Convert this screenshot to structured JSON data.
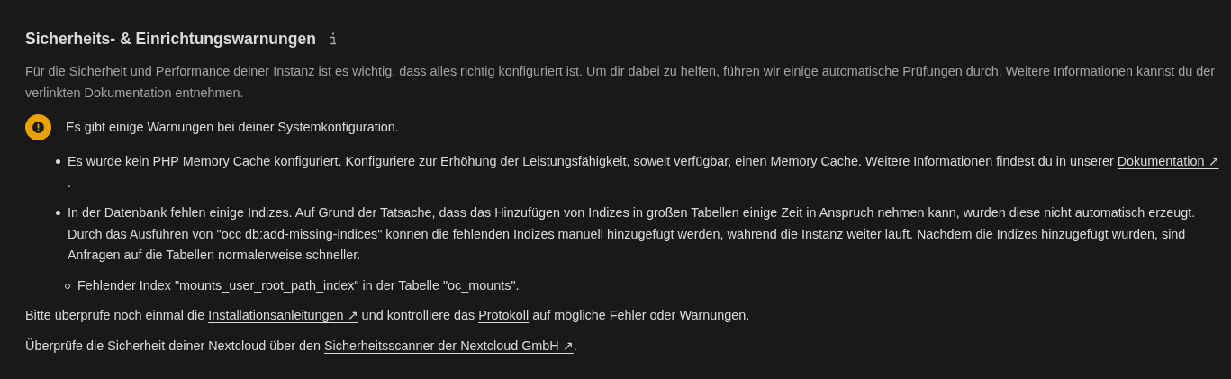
{
  "section": {
    "title": "Sicherheits- & Einrichtungswarnungen",
    "description": "Für die Sicherheit und Performance deiner Instanz ist es wichtig, dass alles richtig konfiguriert ist. Um dir dabei zu helfen, führen wir einige automatische Prüfungen durch. Weitere Informationen kannst du der verlinkten Dokumentation entnehmen.",
    "status": {
      "kind": "warning",
      "text": "Es gibt einige Warnungen bei deiner Systemkonfiguration."
    },
    "issues": [
      {
        "segments": [
          {
            "kind": "text",
            "text": "Es wurde kein PHP Memory Cache konfiguriert. Konfiguriere zur Erhöhung der Leistungsfähigkeit, soweit verfügbar, einen Memory Cache. Weitere Informationen findest du in unserer "
          },
          {
            "kind": "link",
            "text": "Dokumentation ↗"
          },
          {
            "kind": "text",
            "text": " ."
          }
        ]
      },
      {
        "segments": [
          {
            "kind": "text",
            "text": "In der Datenbank fehlen einige Indizes. Auf Grund der Tatsache, dass das Hinzufügen von Indizes in großen Tabellen einige Zeit in Anspruch nehmen kann, wurden diese nicht automatisch erzeugt. Durch das Ausführen von \"occ db:add-missing-indices\" können die fehlenden Indizes manuell hinzugefügt werden, während die Instanz weiter läuft. Nachdem die Indizes hinzugefügt wurden, sind Anfragen auf die Tabellen normalerweise schneller."
          }
        ],
        "children": [
          {
            "segments": [
              {
                "kind": "text",
                "text": "Fehlender Index \"mounts_user_root_path_index\" in der Tabelle \"oc_mounts\"."
              }
            ]
          }
        ]
      }
    ],
    "footer": [
      {
        "segments": [
          {
            "kind": "text",
            "text": "Bitte überprüfe noch einmal die "
          },
          {
            "kind": "link",
            "text": "Installationsanleitungen ↗"
          },
          {
            "kind": "text",
            "text": " und kontrolliere das "
          },
          {
            "kind": "link",
            "text": "Protokoll"
          },
          {
            "kind": "text",
            "text": " auf mögliche Fehler oder Warnungen."
          }
        ]
      },
      {
        "segments": [
          {
            "kind": "text",
            "text": "Überprüfe die Sicherheit deiner Nextcloud über den "
          },
          {
            "kind": "link",
            "text": "Sicherheitsscanner der Nextcloud GmbH ↗"
          },
          {
            "kind": "text",
            "text": "."
          }
        ]
      }
    ]
  }
}
